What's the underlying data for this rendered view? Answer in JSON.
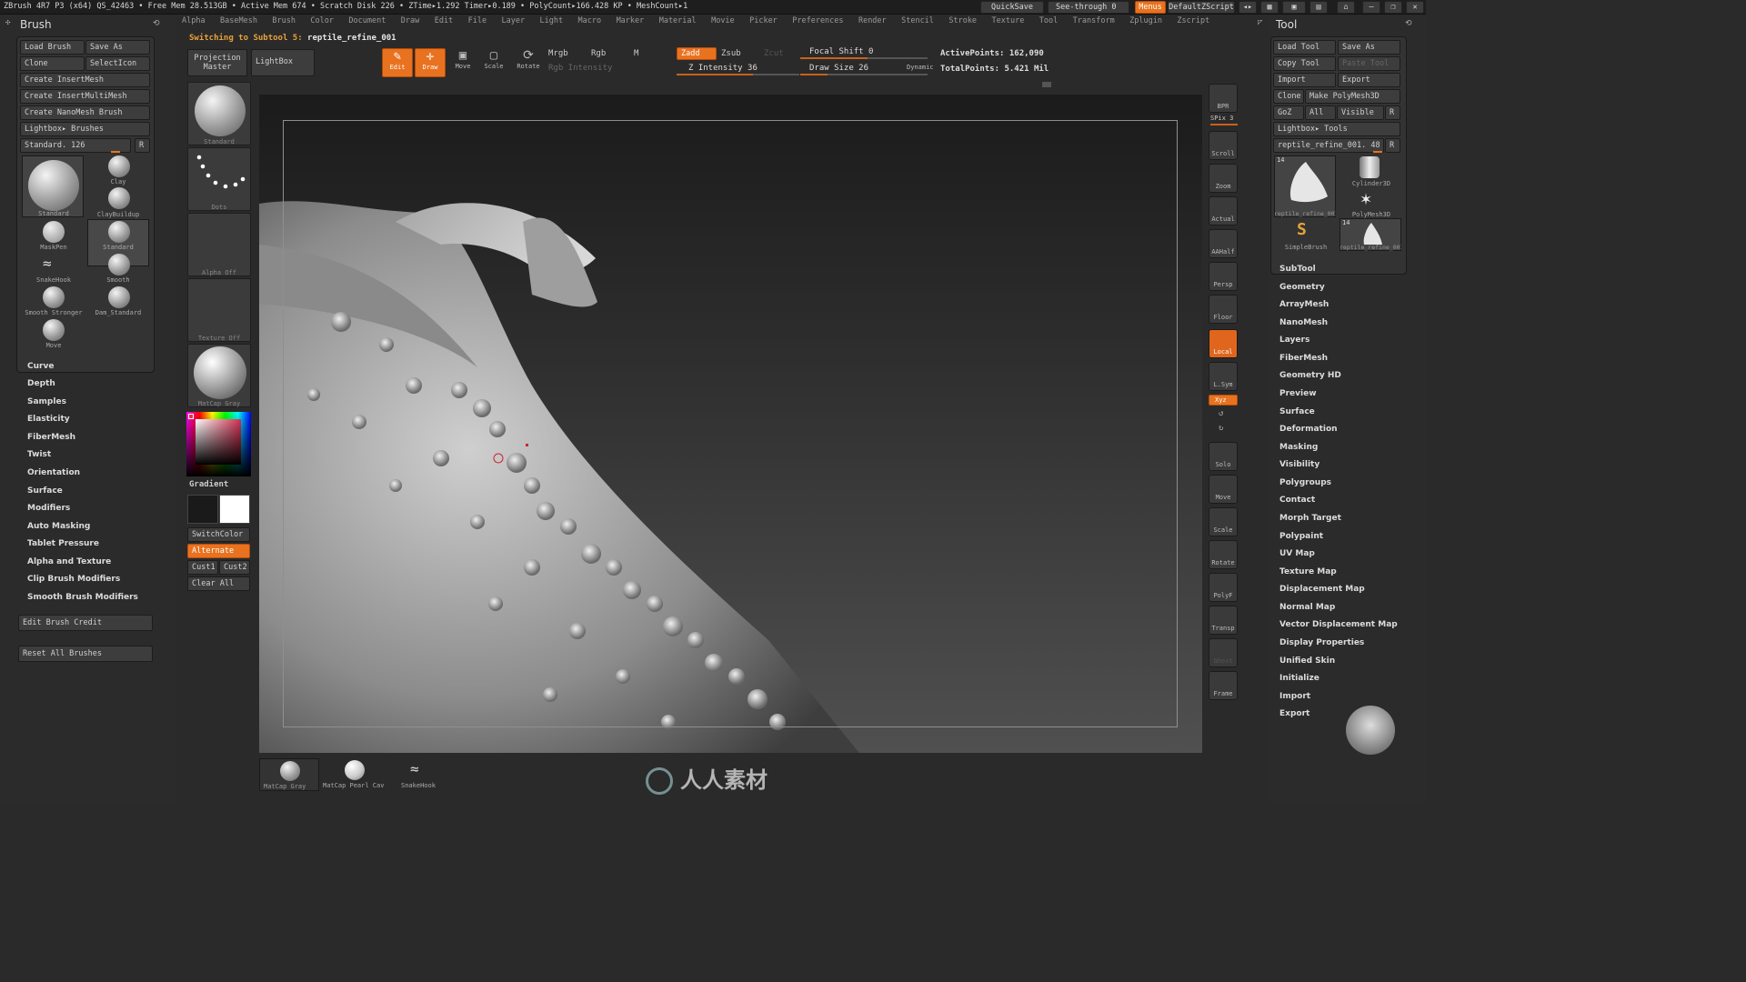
{
  "top": {
    "stats": "ZBrush 4R7 P3 (x64)   QS_42463   • Free Mem 28.513GB • Active Mem 674 • Scratch Disk 226 • ZTime▸1.292 Timer▸0.189 • PolyCount▸166.428 KP • MeshCount▸1",
    "quicksave": "QuickSave",
    "seethrough": "See-through  0",
    "menus": "Menus",
    "script": "DefaultZScript"
  },
  "menu": [
    "Alpha",
    "BaseMesh",
    "Brush",
    "Color",
    "Document",
    "Draw",
    "Edit",
    "File",
    "Layer",
    "Light",
    "Macro",
    "Marker",
    "Material",
    "Movie",
    "Picker",
    "Preferences",
    "Render",
    "Stencil",
    "Stroke",
    "Texture",
    "Tool",
    "Transform",
    "Zplugin",
    "Zscript"
  ],
  "notice": {
    "prefix": "Switching to Subtool 5:",
    "name": "reptile_refine_001"
  },
  "brush": {
    "title": "Brush",
    "buttons": [
      [
        "Load Brush",
        "Save As"
      ],
      [
        "Clone",
        "SelectIcon"
      ]
    ],
    "rows": [
      "Create InsertMesh",
      "Create InsertMultiMesh",
      "Create NanoMesh Brush",
      "Lightbox▸ Brushes"
    ],
    "current": "Standard. 126",
    "r": "R",
    "big_label": "Standard",
    "thumbs": [
      "Clay",
      "ClayBuildup",
      "MaskPen",
      "Standard",
      "SnakeHook",
      "Smooth",
      "Smooth Stronger",
      "Dam_Standard",
      "Move"
    ],
    "sections": [
      "Curve",
      "Depth",
      "Samples",
      "Elasticity",
      "FiberMesh",
      "Twist",
      "Orientation",
      "Surface",
      "Modifiers",
      "Auto Masking",
      "Tablet Pressure",
      "Alpha and Texture",
      "Clip Brush Modifiers",
      "Smooth Brush Modifiers"
    ],
    "edit_credit": "Edit Brush Credit",
    "reset": "Reset All Brushes"
  },
  "mid": {
    "projection": "Projection Master",
    "lightbox": "LightBox",
    "standard": "Standard",
    "dots": "Dots",
    "alpha": "Alpha Off",
    "texture": "Texture Off",
    "matcap": "MatCap Gray",
    "gradient": "Gradient",
    "switch": "SwitchColor",
    "alternate": "Alternate",
    "cust1": "Cust1",
    "cust2": "Cust2",
    "clear": "Clear All"
  },
  "toolbar": {
    "edit": "Edit",
    "draw": "Draw",
    "move": "Move",
    "scale": "Scale",
    "rotate": "Rotate",
    "mrgb": "Mrgb",
    "rgb": "Rgb",
    "m": "M",
    "rgbint": "Rgb Intensity",
    "zadd": "Zadd",
    "zsub": "Zsub",
    "zcut": "Zcut",
    "zint": "Z Intensity 36",
    "focal": "Focal Shift 0",
    "drawsize": "Draw Size 26",
    "dynamic": "Dynamic",
    "active": "ActivePoints: 162,090",
    "total": "TotalPoints: 5.421 Mil"
  },
  "shelf": [
    "BPR",
    "SPix 3",
    "Scroll",
    "Zoom",
    "Actual",
    "AAHalf",
    "Persp",
    "Floor",
    "Local",
    "L.Sym",
    "Xyz",
    "Solo",
    "Move",
    "Scale",
    "Rotate",
    "PolyF",
    "Transp",
    "Ghost",
    "Frame"
  ],
  "tool": {
    "title": "Tool",
    "buttons": [
      [
        "Load Tool",
        "Save As"
      ],
      [
        "Copy Tool",
        "Paste Tool"
      ],
      [
        "Import",
        "Export"
      ]
    ],
    "clone": "Clone",
    "make": "Make PolyMesh3D",
    "goz": "GoZ",
    "all": "All",
    "visible": "Visible",
    "r": "R",
    "lightbox": "Lightbox▸ Tools",
    "current": "reptile_refine_001. 48",
    "thumbs": [
      "reptile_refine_001",
      "Cylinder3D",
      "PolyMesh3D",
      "SimpleBrush",
      "reptile_refine_001"
    ],
    "badge1": "14",
    "badge2": "14",
    "sections": [
      "SubTool",
      "Geometry",
      "ArrayMesh",
      "NanoMesh",
      "Layers",
      "FiberMesh",
      "Geometry HD",
      "Preview",
      "Surface",
      "Deformation",
      "Masking",
      "Visibility",
      "Polygroups",
      "Contact",
      "Morph Target",
      "Polypaint",
      "UV Map",
      "Texture Map",
      "Displacement Map",
      "Normal Map",
      "Vector Displacement Map",
      "Display Properties",
      "Unified Skin",
      "Initialize",
      "Import",
      "Export"
    ]
  },
  "bottom": [
    "MatCap Gray",
    "MatCap Pearl Cav",
    "SnakeHook"
  ],
  "watermark": "人人素材"
}
